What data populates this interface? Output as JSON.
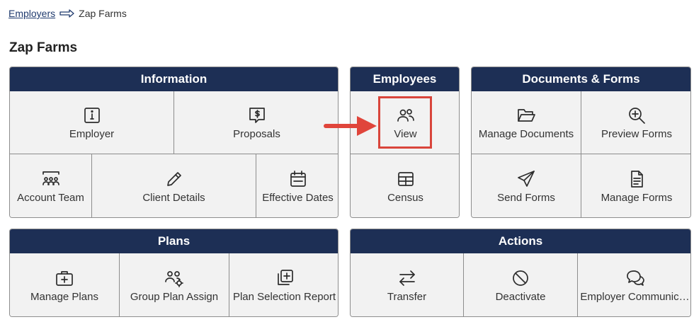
{
  "breadcrumb": {
    "parent": "Employers",
    "current": "Zap Farms"
  },
  "page": {
    "title": "Zap Farms"
  },
  "panels": {
    "information": {
      "title": "Information",
      "employer": "Employer",
      "proposals": "Proposals",
      "account_team": "Account Team",
      "client_details": "Client Details",
      "effective_dates": "Effective Dates"
    },
    "employees": {
      "title": "Employees",
      "view": "View",
      "census": "Census"
    },
    "documents": {
      "title": "Documents & Forms",
      "manage_documents": "Manage Documents",
      "preview_forms": "Preview Forms",
      "send_forms": "Send Forms",
      "manage_forms": "Manage Forms"
    },
    "plans": {
      "title": "Plans",
      "manage_plans": "Manage Plans",
      "group_plan_assign": "Group Plan Assign",
      "plan_selection_report": "Plan Selection Report"
    },
    "actions": {
      "title": "Actions",
      "transfer": "Transfer",
      "deactivate": "Deactivate",
      "employer_communications": "Employer Communic…"
    }
  },
  "colors": {
    "header": "#1d2f55",
    "tile": "#f2f2f2",
    "highlight": "#d9453b",
    "link": "#1f3a6e"
  }
}
